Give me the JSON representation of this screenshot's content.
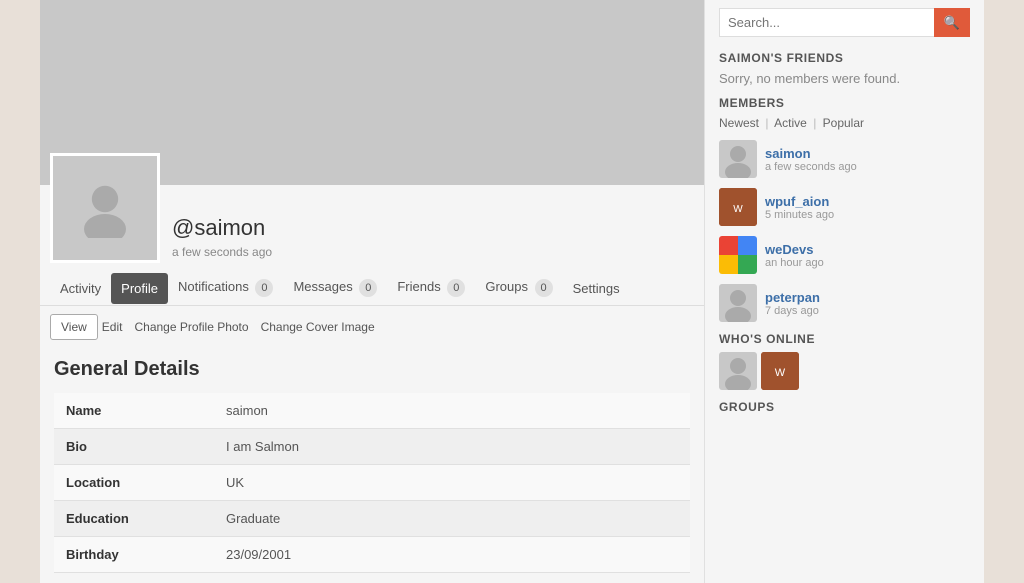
{
  "cover": {
    "alt": "Cover image area"
  },
  "profile": {
    "username": "@saimon",
    "last_seen": "a few seconds ago"
  },
  "tabs": {
    "items": [
      {
        "label": "Activity",
        "active": false,
        "badge": null
      },
      {
        "label": "Profile",
        "active": true,
        "badge": null
      },
      {
        "label": "Notifications",
        "active": false,
        "badge": "0"
      },
      {
        "label": "Messages",
        "active": false,
        "badge": "0"
      },
      {
        "label": "Friends",
        "active": false,
        "badge": "0"
      },
      {
        "label": "Groups",
        "active": false,
        "badge": "0"
      },
      {
        "label": "Settings",
        "active": false,
        "badge": null
      }
    ],
    "sub_items": [
      {
        "label": "View",
        "active": true
      },
      {
        "label": "Edit",
        "active": false
      },
      {
        "label": "Change Profile Photo",
        "active": false
      },
      {
        "label": "Change Cover Image",
        "active": false
      }
    ]
  },
  "general_details": {
    "title": "General Details",
    "rows": [
      {
        "field": "Name",
        "value": "saimon"
      },
      {
        "field": "Bio",
        "value": "I am Salmon"
      },
      {
        "field": "Location",
        "value": "UK"
      },
      {
        "field": "Education",
        "value": "Graduate"
      },
      {
        "field": "Birthday",
        "value": "23/09/2001"
      }
    ]
  },
  "sidebar": {
    "search_placeholder": "Search...",
    "friends_title": "SAIMON'S FRIENDS",
    "no_members_text": "Sorry, no members were found.",
    "members_title": "MEMBERS",
    "filter_newest": "Newest",
    "filter_active": "Active",
    "filter_popular": "Popular",
    "members": [
      {
        "name": "saimon",
        "time": "a few seconds ago",
        "type": "default"
      },
      {
        "name": "wpuf_aion",
        "time": "5 minutes ago",
        "type": "wpuf"
      },
      {
        "name": "weDevs",
        "time": "an hour ago",
        "type": "wedevs"
      },
      {
        "name": "peterpan",
        "time": "7 days ago",
        "type": "default"
      }
    ],
    "whos_online_title": "WHO'S ONLINE",
    "groups_title": "GROUPS"
  }
}
